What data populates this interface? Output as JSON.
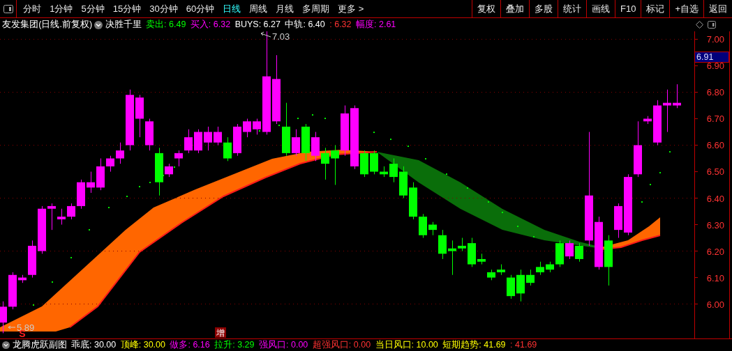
{
  "toolbar": {
    "periods": [
      {
        "label": "分时",
        "selected": false
      },
      {
        "label": "1分钟",
        "selected": false
      },
      {
        "label": "5分钟",
        "selected": false
      },
      {
        "label": "15分钟",
        "selected": false
      },
      {
        "label": "30分钟",
        "selected": false
      },
      {
        "label": "60分钟",
        "selected": false
      },
      {
        "label": "日线",
        "selected": true
      },
      {
        "label": "周线",
        "selected": false
      },
      {
        "label": "月线",
        "selected": false
      },
      {
        "label": "多周期",
        "selected": false
      },
      {
        "label": "更多 >",
        "selected": false
      }
    ],
    "actions": [
      "复权",
      "叠加",
      "多股",
      "统计",
      "画线",
      "F10",
      "标记",
      "+自选",
      "返回"
    ]
  },
  "header": {
    "title": "友发集团(日线.前复权)",
    "indicator": "决胜千里",
    "values": [
      {
        "label": "卖出:",
        "value": "6.49",
        "color": "#00ff00"
      },
      {
        "label": "买入:",
        "value": "6.32",
        "color": "#ff00ff"
      },
      {
        "label": "BUYS:",
        "value": "6.27",
        "color": "#ffffff"
      },
      {
        "label": "中轨:",
        "value": "6.40",
        "color": "#ffffff"
      },
      {
        "label": ":",
        "value": "6.32",
        "color": "#ff3232"
      },
      {
        "label": "幅度:",
        "value": "2.61",
        "color": "#ff00ff"
      }
    ]
  },
  "chart": {
    "chart_data": {
      "type": "candlestick",
      "ohlc": [
        [
          5.93,
          6.01,
          5.89,
          5.99
        ],
        [
          5.99,
          6.12,
          5.98,
          6.11
        ],
        [
          6.09,
          6.11,
          6.08,
          6.1
        ],
        [
          6.11,
          6.24,
          6.1,
          6.22
        ],
        [
          6.2,
          6.37,
          6.19,
          6.36
        ],
        [
          6.36,
          6.38,
          6.28,
          6.37
        ],
        [
          6.32,
          6.36,
          6.3,
          6.33
        ],
        [
          6.33,
          6.38,
          6.32,
          6.37
        ],
        [
          6.37,
          6.47,
          6.36,
          6.46
        ],
        [
          6.44,
          6.5,
          6.42,
          6.46
        ],
        [
          6.44,
          6.55,
          6.43,
          6.52
        ],
        [
          6.52,
          6.56,
          6.5,
          6.55
        ],
        [
          6.55,
          6.61,
          6.53,
          6.58
        ],
        [
          6.6,
          6.81,
          6.58,
          6.79
        ],
        [
          6.7,
          6.79,
          6.63,
          6.78
        ],
        [
          6.6,
          6.7,
          6.58,
          6.69
        ],
        [
          6.57,
          6.59,
          6.41,
          6.46
        ],
        [
          6.49,
          6.53,
          6.48,
          6.52
        ],
        [
          6.55,
          6.58,
          6.52,
          6.57
        ],
        [
          6.58,
          6.66,
          6.57,
          6.63
        ],
        [
          6.58,
          6.66,
          6.57,
          6.65
        ],
        [
          6.61,
          6.67,
          6.58,
          6.65
        ],
        [
          6.61,
          6.67,
          6.6,
          6.65
        ],
        [
          6.61,
          6.63,
          6.54,
          6.55
        ],
        [
          6.57,
          6.68,
          6.56,
          6.67
        ],
        [
          6.65,
          6.7,
          6.63,
          6.69
        ],
        [
          6.66,
          6.7,
          6.64,
          6.69
        ],
        [
          6.65,
          7.03,
          6.64,
          6.86
        ],
        [
          6.69,
          6.94,
          6.68,
          6.85
        ],
        [
          6.67,
          6.76,
          6.56,
          6.57
        ],
        [
          6.57,
          6.66,
          6.56,
          6.63
        ],
        [
          6.67,
          6.68,
          6.54,
          6.57
        ],
        [
          6.56,
          6.65,
          6.54,
          6.63
        ],
        [
          6.57,
          6.59,
          6.47,
          6.53
        ],
        [
          6.58,
          6.6,
          6.45,
          6.55
        ],
        [
          6.58,
          6.75,
          6.56,
          6.72
        ],
        [
          6.52,
          6.75,
          6.51,
          6.74
        ],
        [
          6.57,
          6.58,
          6.48,
          6.49
        ],
        [
          6.57,
          6.58,
          6.49,
          6.5
        ],
        [
          6.5,
          6.52,
          6.48,
          6.49
        ],
        [
          6.53,
          6.55,
          6.46,
          6.48
        ],
        [
          6.5,
          6.52,
          6.4,
          6.41
        ],
        [
          6.44,
          6.46,
          6.32,
          6.33
        ],
        [
          6.33,
          6.34,
          6.25,
          6.26
        ],
        [
          6.3,
          6.31,
          6.26,
          6.28
        ],
        [
          6.26,
          6.28,
          6.17,
          6.19
        ],
        [
          6.21,
          6.24,
          6.11,
          6.2
        ],
        [
          6.22,
          6.25,
          6.2,
          6.21
        ],
        [
          6.23,
          6.25,
          6.14,
          6.15
        ],
        [
          6.17,
          6.19,
          6.15,
          6.16
        ],
        [
          6.12,
          6.13,
          6.09,
          6.1
        ],
        [
          6.13,
          6.15,
          6.11,
          6.12
        ],
        [
          6.1,
          6.11,
          6.02,
          6.03
        ],
        [
          6.11,
          6.13,
          6.01,
          6.04
        ],
        [
          6.11,
          6.13,
          6.07,
          6.08
        ],
        [
          6.14,
          6.16,
          6.11,
          6.12
        ],
        [
          6.15,
          6.16,
          6.12,
          6.13
        ],
        [
          6.23,
          6.24,
          6.14,
          6.15
        ],
        [
          6.18,
          6.24,
          6.17,
          6.23
        ],
        [
          6.22,
          6.23,
          6.16,
          6.17
        ],
        [
          6.24,
          6.65,
          6.22,
          6.41
        ],
        [
          6.14,
          6.33,
          6.13,
          6.31
        ],
        [
          6.24,
          6.26,
          6.07,
          6.14
        ],
        [
          6.28,
          6.38,
          6.25,
          6.37
        ],
        [
          6.27,
          6.49,
          6.26,
          6.48
        ],
        [
          6.49,
          6.69,
          6.48,
          6.6
        ],
        [
          6.69,
          6.71,
          6.68,
          6.7
        ],
        [
          6.61,
          6.77,
          6.6,
          6.75
        ],
        [
          6.75,
          6.81,
          6.65,
          6.76
        ],
        [
          6.75,
          6.83,
          6.74,
          6.76
        ]
      ],
      "ylim": [
        5.87,
        7.03
      ],
      "grid": true,
      "yticks": [
        {
          "value": 7.0,
          "label": "7.00"
        },
        {
          "value": 6.9,
          "label": "6.90"
        },
        {
          "value": 6.8,
          "label": "6.80"
        },
        {
          "value": 6.7,
          "label": "6.70"
        },
        {
          "value": 6.6,
          "label": "6.60"
        },
        {
          "value": 6.5,
          "label": "6.50"
        },
        {
          "value": 6.4,
          "label": "6.40"
        },
        {
          "value": 6.3,
          "label": "6.30"
        },
        {
          "value": 6.2,
          "label": "6.20"
        },
        {
          "value": 6.1,
          "label": "6.10"
        },
        {
          "value": 6.0,
          "label": "6.00"
        }
      ]
    },
    "current_price": "6.91",
    "high_marker": "7.03",
    "low_marker": "5.89",
    "signal_marks": [
      {
        "kind": "sell",
        "text": "S"
      },
      {
        "kind": "add",
        "text": "增"
      }
    ]
  },
  "sub_indicator": {
    "name": "龙腾虎跃副图",
    "values": [
      {
        "label": "乖底:",
        "value": "30.00",
        "color": "#ffffff"
      },
      {
        "label": "顶峰:",
        "value": "30.00",
        "color": "#ffff00"
      },
      {
        "label": "做多:",
        "value": "6.16",
        "color": "#ff00ff"
      },
      {
        "label": "拉升:",
        "value": "3.29",
        "color": "#00ff00"
      },
      {
        "label": "强风口:",
        "value": "0.00",
        "color": "#ff00ff"
      },
      {
        "label": "超强风口:",
        "value": "0.00",
        "color": "#ff3232"
      },
      {
        "label": "当日风口:",
        "value": "10.00",
        "color": "#ffff00"
      },
      {
        "label": "短期趋势:",
        "value": "41.69",
        "color": "#ffff00"
      },
      {
        "label": ":",
        "value": "41.69",
        "color": "#ff3232"
      }
    ]
  }
}
